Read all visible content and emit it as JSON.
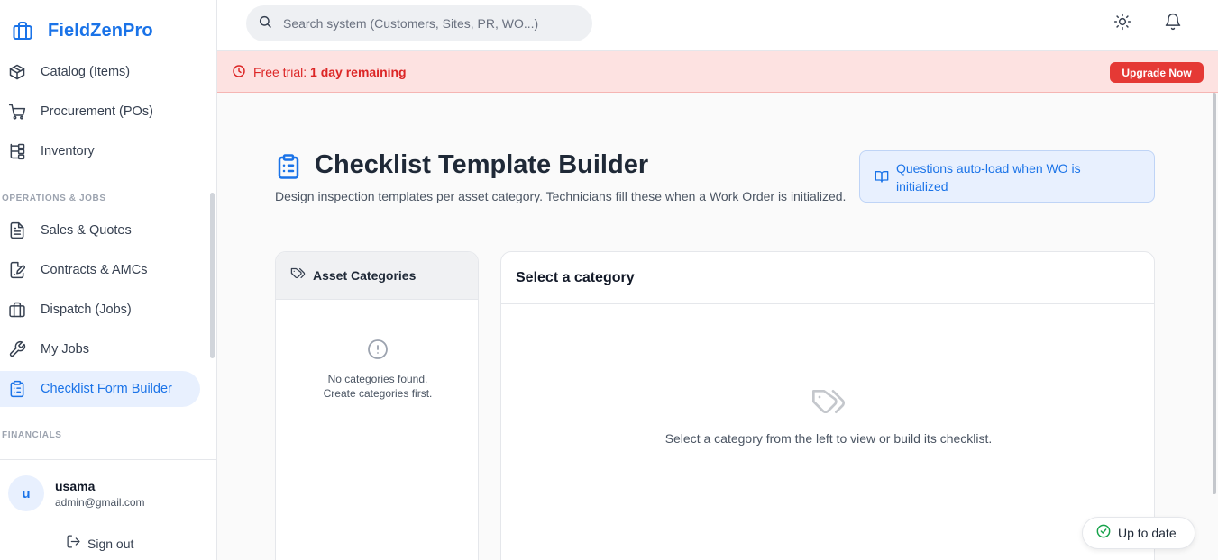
{
  "brand": {
    "name": "FieldZenPro",
    "icon": "briefcase-icon",
    "color": "#1a73e8"
  },
  "sidebar": {
    "items": [
      {
        "label": "Catalog (Items)",
        "icon": "box-icon"
      },
      {
        "label": "Procurement (POs)",
        "icon": "cart-icon"
      },
      {
        "label": "Inventory",
        "icon": "hierarchy-icon"
      },
      {
        "label": "Sales & Quotes",
        "icon": "document-icon"
      },
      {
        "label": "Contracts & AMCs",
        "icon": "signed-document-icon"
      },
      {
        "label": "Dispatch (Jobs)",
        "icon": "briefcase-icon"
      },
      {
        "label": "My Jobs",
        "icon": "wrench-icon"
      },
      {
        "label": "Checklist Form Builder",
        "icon": "clipboard-icon",
        "active": true
      }
    ],
    "sections": {
      "operations": "OPERATIONS & JOBS",
      "financials": "FINANCIALS"
    }
  },
  "user": {
    "initial": "u",
    "name": "usama",
    "email": "admin@gmail.com",
    "signout_label": "Sign out"
  },
  "search": {
    "placeholder": "Search system (Customers, Sites, PR, WO...)"
  },
  "topbar": {
    "theme_icon": "sun-icon",
    "notifications_icon": "bell-icon"
  },
  "trial": {
    "prefix": "Free trial: ",
    "remaining": "1 day remaining",
    "upgrade_label": "Upgrade Now",
    "color": "#e53935"
  },
  "page": {
    "title": "Checklist Template Builder",
    "subtitle": "Design inspection templates per asset category. Technicians fill these when a Work Order is initialized.",
    "info": "Questions auto-load when WO is initialized"
  },
  "categories": {
    "header": "Asset Categories",
    "empty_line1": "No categories found.",
    "empty_line2": "Create categories first."
  },
  "detail": {
    "header": "Select a category",
    "empty_message": "Select a category from the left to view or build its checklist."
  },
  "status": {
    "label": "Up to date",
    "color": "#16a34a"
  }
}
